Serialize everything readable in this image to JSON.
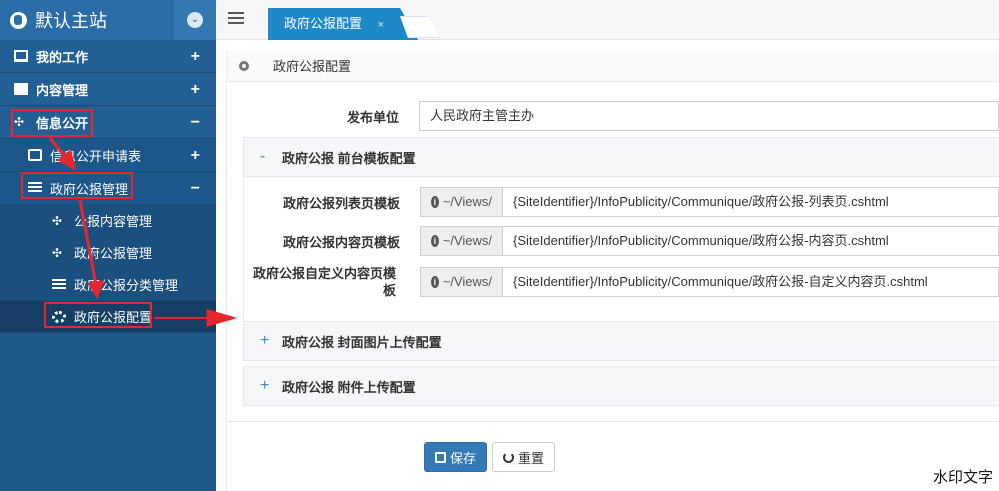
{
  "sidebar": {
    "brand": "默认主站",
    "items": [
      {
        "label": "我的工作",
        "sign": "+"
      },
      {
        "label": "内容管理",
        "sign": "+"
      },
      {
        "label": "信息公开",
        "sign": "−"
      },
      {
        "label": "信息公开申请表",
        "sign": "+"
      },
      {
        "label": "政府公报管理",
        "sign": "−"
      },
      {
        "label": "公报内容管理"
      },
      {
        "label": "政府公报管理"
      },
      {
        "label": "政府公报分类管理"
      },
      {
        "label": "政府公报配置"
      }
    ]
  },
  "tabs": [
    {
      "label": "政府公报配置",
      "close": "×"
    }
  ],
  "breadcrumb": "政府公报配置",
  "form": {
    "publisher_label": "发布单位",
    "publisher_value": "人民政府主管主办",
    "sections": [
      {
        "title": "政府公报 前台模板配置",
        "sign": "-"
      },
      {
        "title": "政府公报 封面图片上传配置",
        "sign": "+"
      },
      {
        "title": "政府公报 附件上传配置",
        "sign": "+"
      }
    ],
    "templates": [
      {
        "label": "政府公报列表页模板",
        "prefix": "~/Views/",
        "value": "{SiteIdentifier}/InfoPublicity/Communique/政府公报-列表页.cshtml"
      },
      {
        "label": "政府公报内容页模板",
        "prefix": "~/Views/",
        "value": "{SiteIdentifier}/InfoPublicity/Communique/政府公报-内容页.cshtml"
      },
      {
        "label": "政府公报自定义内容页模板",
        "prefix": "~/Views/",
        "value": "{SiteIdentifier}/InfoPublicity/Communique/政府公报-自定义内容页.cshtml"
      }
    ],
    "save_label": "保存",
    "reset_label": "重置"
  },
  "watermark": "水印文字",
  "colors": {
    "sidebar": "#225f94",
    "tab": "#1e88c8",
    "primary": "#337ab7",
    "annotation": "#e8262b"
  }
}
